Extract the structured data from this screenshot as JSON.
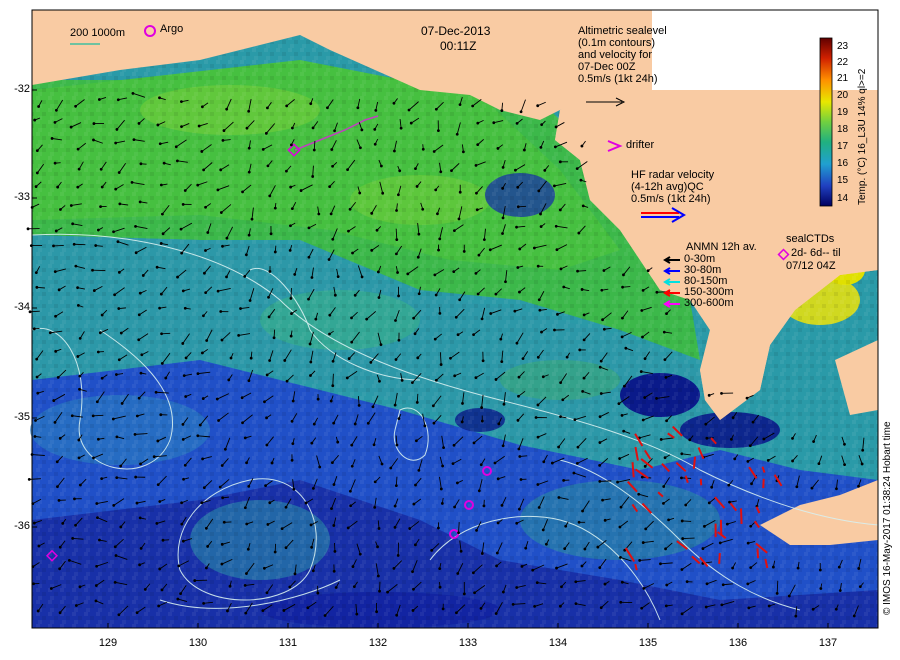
{
  "header": {
    "date": "07-Dec-2013",
    "time": "00:11Z"
  },
  "scale_bar": {
    "label": "200  1000m"
  },
  "argo_label": "Argo",
  "altimetry": {
    "lines": [
      "Altimetric sealevel",
      "(0.1m contours)",
      "and velocity for",
      "07-Dec 00Z",
      "0.5m/s (1kt 24h)"
    ]
  },
  "drifter_label": "drifter",
  "hf_radar": {
    "lines": [
      "HF radar velocity",
      "(4-12h avg)QC",
      "0.5m/s (1kt 24h)"
    ]
  },
  "anmn": {
    "title": "ANMN 12h av.",
    "items": [
      {
        "label": "0-30m",
        "color": "#000000"
      },
      {
        "label": "30-80m",
        "color": "#0000ff"
      },
      {
        "label": "80-150m",
        "color": "#00e0e0"
      },
      {
        "label": "150-300m",
        "color": "#ff0000"
      },
      {
        "label": "300-600m",
        "color": "#ff00ff"
      }
    ]
  },
  "seal_ctd": {
    "lines": [
      "sealCTDs",
      "2d- 6d-- til",
      "07/12 04Z"
    ]
  },
  "colorbar": {
    "ticks": [
      "23",
      "22",
      "21",
      "20",
      "19",
      "18",
      "17",
      "16",
      "15",
      "14"
    ],
    "title": "Temp. (°C) 16_L3U 14% ql>=2"
  },
  "credit": "© IMOS 16-May-2017 01:38:24 Hobart time",
  "axes": {
    "y_ticks": [
      "-32",
      "-33",
      "-34",
      "-35",
      "-36"
    ],
    "x_ticks": [
      "129",
      "130",
      "131",
      "132",
      "133",
      "134",
      "135",
      "136",
      "137"
    ]
  },
  "colors": {
    "land": "#f9cba3",
    "ocean_warm": "#3cb84a",
    "ocean_mid": "#2a9aa8",
    "ocean_cool": "#2050c8",
    "ocean_cold": "#0a1a8a",
    "contour": "#d8f0f0"
  }
}
